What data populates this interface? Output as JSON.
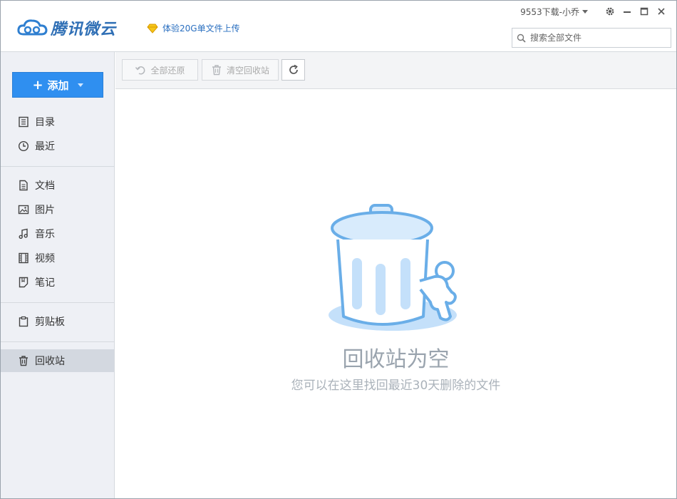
{
  "header": {
    "logo_text": "腾讯微云",
    "promo_text": "体验20G单文件上传",
    "user_name": "9553下载-小乔"
  },
  "search": {
    "placeholder": "搜索全部文件"
  },
  "sidebar": {
    "add_label": "添加",
    "items": [
      {
        "label": "目录",
        "icon": "catalog-icon"
      },
      {
        "label": "最近",
        "icon": "clock-icon"
      },
      {
        "label": "文档",
        "icon": "document-icon"
      },
      {
        "label": "图片",
        "icon": "image-icon"
      },
      {
        "label": "音乐",
        "icon": "music-icon"
      },
      {
        "label": "视频",
        "icon": "film-icon"
      },
      {
        "label": "笔记",
        "icon": "note-icon"
      },
      {
        "label": "剪贴板",
        "icon": "clipboard-icon"
      },
      {
        "label": "回收站",
        "icon": "trash-icon",
        "active": true
      }
    ]
  },
  "toolbar": {
    "restore_all_label": "全部还原",
    "empty_bin_label": "清空回收站"
  },
  "empty_state": {
    "title": "回收站为空",
    "subtitle": "您可以在这里找回最近30天删除的文件"
  },
  "colors": {
    "accent": "#2f8ff0",
    "logo": "#2f6fb5",
    "sidebar_bg": "#eef0f5",
    "active_item_bg": "#d3d8e0",
    "illustration_stroke": "#6aaee8",
    "illustration_fill": "#c4e0fa"
  }
}
